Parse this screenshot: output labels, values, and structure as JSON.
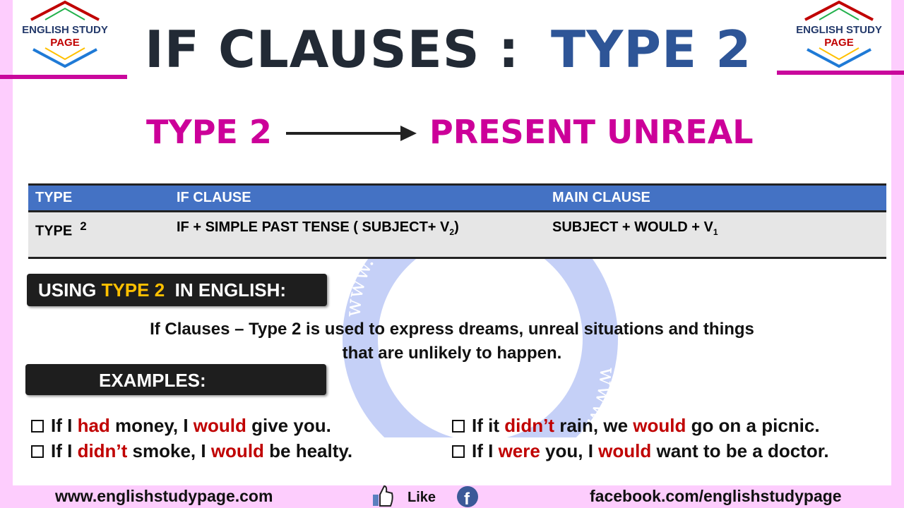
{
  "logo": {
    "line1": "ENGLISH STUDY",
    "line2": "PAGE"
  },
  "title": {
    "part1": "IF CLAUSES :",
    "part2": "TYPE 2"
  },
  "subtitle": {
    "left": "TYPE 2",
    "right": "PRESENT UNREAL"
  },
  "table": {
    "headers": [
      "TYPE",
      "IF CLAUSE",
      "MAIN CLAUSE"
    ],
    "row": {
      "type": "TYPE",
      "type_num": "2",
      "if_clause": "IF + SIMPLE PAST TENSE ( SUBJECT+ V",
      "if_sub": "2",
      "if_end": ")",
      "main": "SUBJECT + WOULD + V",
      "main_sub": "1"
    }
  },
  "using": {
    "pre": "USING ",
    "hl": "TYPE 2",
    "post": "  IN ENGLISH:"
  },
  "description": {
    "line1": "If Clauses – Type 2 is used to express dreams, unreal situations and things",
    "line2": "that are unlikely to happen."
  },
  "examples_label": "EXAMPLES:",
  "examples": [
    {
      "a": "If I ",
      "b": "had",
      "c": " money, I ",
      "d": "would",
      "e": " give you."
    },
    {
      "a": "If I ",
      "b": "didn’t",
      "c": " smoke, I ",
      "d": "would",
      "e": " be healty."
    },
    {
      "a": "If it ",
      "b": "didn’t",
      "c": " rain, we ",
      "d": "would",
      "e": " go on a picnic."
    },
    {
      "a": "If I ",
      "b": "were",
      "c": " you, I ",
      "d": "would",
      "e": " want to be a doctor."
    }
  ],
  "watermark": "www.englishstudypage.com",
  "footer": {
    "website": "www.englishstudypage.com",
    "like": "Like",
    "facebook": "facebook.com/englishstudypage"
  },
  "colors": {
    "magenta": "#cc0099",
    "blue": "#2e5597",
    "header_blue": "#4472c4",
    "red": "#c00000",
    "yellow": "#ffc000"
  }
}
